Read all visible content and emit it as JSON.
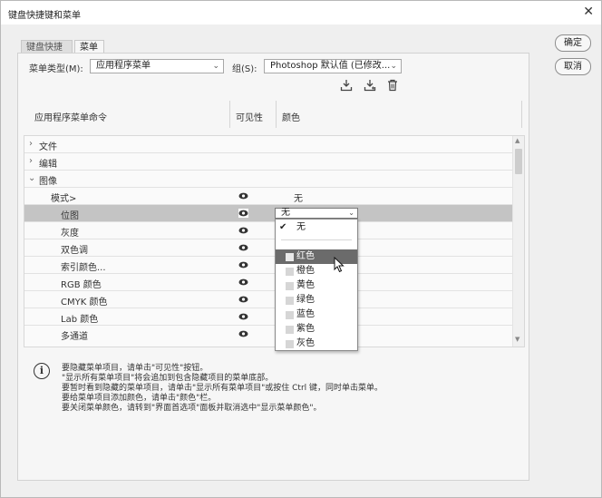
{
  "window": {
    "title": "键盘快捷键和菜单"
  },
  "buttons": {
    "ok": "确定",
    "cancel": "取消"
  },
  "tabs": [
    {
      "label": "键盘快捷键"
    },
    {
      "label": "菜单"
    }
  ],
  "menu_type": {
    "label": "菜单类型(M):",
    "value": "应用程序菜单"
  },
  "set": {
    "label": "组(S):",
    "value": "Photoshop 默认值 (已修改..."
  },
  "columns": {
    "command": "应用程序菜单命令",
    "visibility": "可见性",
    "color": "颜色"
  },
  "rows": [
    {
      "label": "文件",
      "expander": "›"
    },
    {
      "label": "编辑",
      "expander": "›"
    },
    {
      "label": "图像",
      "expander": "⌄"
    },
    {
      "label": "模式>",
      "color": "无"
    },
    {
      "label": "位图",
      "color": "无"
    },
    {
      "label": "灰度"
    },
    {
      "label": "双色调"
    },
    {
      "label": "索引颜色..."
    },
    {
      "label": "RGB 颜色"
    },
    {
      "label": "CMYK 颜色"
    },
    {
      "label": "Lab 颜色"
    },
    {
      "label": "多通道"
    }
  ],
  "dropdown": {
    "current": "无",
    "none_option": "无",
    "check": "✔",
    "options": [
      "红色",
      "橙色",
      "黄色",
      "绿色",
      "蓝色",
      "紫色",
      "灰色"
    ],
    "highlighted": "红色"
  },
  "info": {
    "lines": [
      "要隐藏菜单项目，请单击\"可见性\"按钮。",
      "\"显示所有菜单项目\"将会追加到包含隐藏项目的菜单底部。",
      "要暂时看到隐藏的菜单项目，请单击\"显示所有菜单项目\"或按住 Ctrl 键，同时单击菜单。",
      "要给菜单项目添加颜色，请单击\"颜色\"栏。",
      "要关闭菜单颜色，请转到\"界面首选项\"面板并取消选中\"显示菜单颜色\"。"
    ]
  },
  "icons": {
    "info": "info-icon",
    "eye": "eye-icon",
    "save_set": "save-set-icon",
    "save_set_as": "save-set-as-icon",
    "delete_set": "trash-icon"
  }
}
